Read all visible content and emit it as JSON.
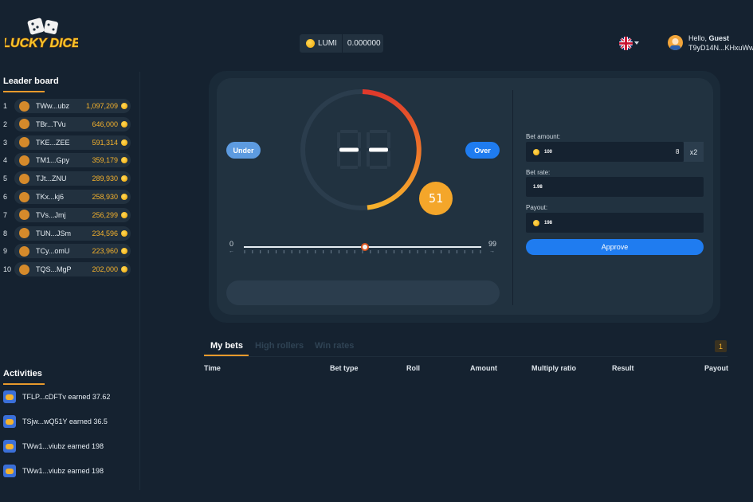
{
  "header": {
    "logo_text": "LUCKY DICE",
    "currency": "LUMI",
    "balance": "0.000000",
    "greeting_prefix": "Hello,",
    "greeting_name": "Guest",
    "user_id": "T9yD14N...KHxuWwb"
  },
  "leaderboard": {
    "title": "Leader board",
    "rows": [
      {
        "rank": "1",
        "name": "TWw...ubz",
        "score": "1,097,209"
      },
      {
        "rank": "2",
        "name": "TBr...TVu",
        "score": "646,000"
      },
      {
        "rank": "3",
        "name": "TKE...ZEE",
        "score": "591,314"
      },
      {
        "rank": "4",
        "name": "TM1...Gpy",
        "score": "359,179"
      },
      {
        "rank": "5",
        "name": "TJt...ZNU",
        "score": "289,930"
      },
      {
        "rank": "6",
        "name": "TKx...kj6",
        "score": "258,930"
      },
      {
        "rank": "7",
        "name": "TVs...Jmj",
        "score": "256,299"
      },
      {
        "rank": "8",
        "name": "TUN...JSm",
        "score": "234,596"
      },
      {
        "rank": "9",
        "name": "TCy...omU",
        "score": "223,960"
      },
      {
        "rank": "10",
        "name": "TQS...MgP",
        "score": "202,000"
      }
    ]
  },
  "activities": {
    "title": "Activities",
    "items": [
      "TFLP...cDFTv earned 37.62",
      "TSjw...wQ51Y earned 36.5",
      "TWw1...viubz earned 198",
      "TWw1...viubz earned 198"
    ]
  },
  "game": {
    "under_label": "Under",
    "over_label": "Over",
    "roll_display": "--",
    "target": "51",
    "slider_min": "0",
    "slider_max": "99",
    "slider_value": 51,
    "bet_amount_label": "Bet amount:",
    "bet_amount": "100",
    "stepper": "8",
    "multiplier": "x2",
    "bet_rate_label": "Bet rate:",
    "bet_rate": "1.98",
    "payout_label": "Payout:",
    "payout": "198",
    "approve_label": "Approve"
  },
  "tabs": [
    "My bets",
    "High rollers",
    "Win rates"
  ],
  "page": "1",
  "table": {
    "columns": [
      "Time",
      "Bet type",
      "Roll",
      "Amount",
      "Multiply ratio",
      "Result",
      "Payout"
    ]
  },
  "colors": {
    "background": "#152230",
    "accent_orange": "#e89a2c",
    "primary_blue": "#1f7cf0",
    "coin_gold": "#f5b22c"
  }
}
